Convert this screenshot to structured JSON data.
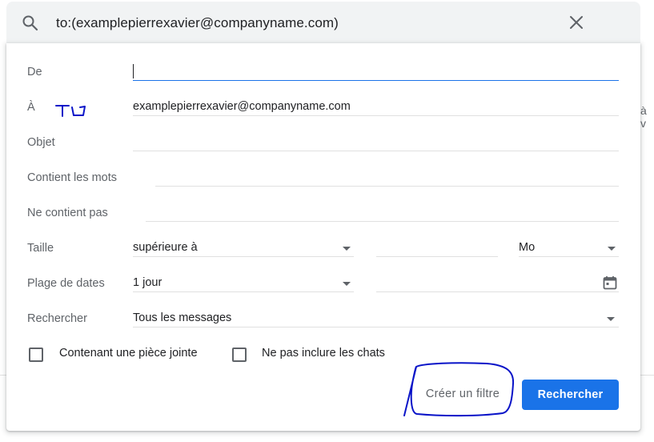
{
  "search": {
    "query": "to:(examplepierrexavier@companyname.com)"
  },
  "background": {
    "right_text": "à v"
  },
  "form": {
    "from": {
      "label": "De",
      "value": ""
    },
    "to": {
      "label": "À",
      "value": "examplepierrexavier@companyname.com",
      "annotation": "TO"
    },
    "subject": {
      "label": "Objet",
      "value": ""
    },
    "has_words": {
      "label": "Contient les mots",
      "value": ""
    },
    "doesnt_have": {
      "label": "Ne contient pas",
      "value": ""
    },
    "size": {
      "label": "Taille",
      "operator": "supérieure à",
      "value": "",
      "unit": "Mo"
    },
    "date_range": {
      "label": "Plage de dates",
      "value": "1 jour",
      "date": ""
    },
    "search_in": {
      "label": "Rechercher",
      "value": "Tous les messages"
    },
    "has_attachment": {
      "label": "Contenant une pièce jointe",
      "checked": false
    },
    "exclude_chats": {
      "label": "Ne pas inclure les chats",
      "checked": false
    }
  },
  "actions": {
    "create_filter_label": "Créer un filtre",
    "search_label": "Rechercher"
  },
  "colors": {
    "accent": "#1a73e8",
    "annotation_ink": "#0a14c8"
  }
}
